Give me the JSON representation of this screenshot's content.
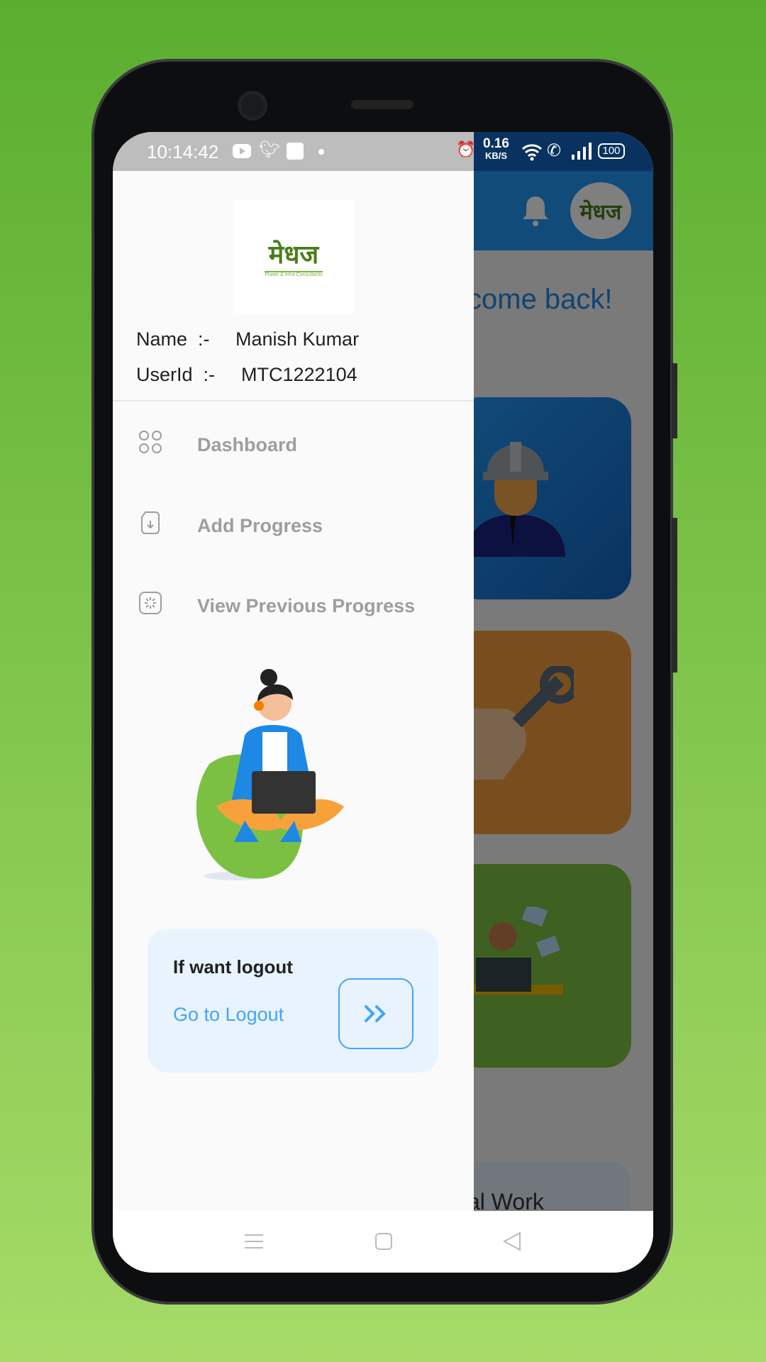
{
  "status_bar": {
    "time": "10:14:42",
    "net_speed": "0.16",
    "net_unit": "KB/S",
    "battery": "100",
    "icons": [
      "youtube-icon",
      "twitter-icon",
      "photo-icon",
      "dot-icon",
      "alarm-icon",
      "wifi-icon",
      "wifi-call-icon",
      "signal-icon",
      "battery-icon"
    ]
  },
  "drawer": {
    "logo_text": "मेधज",
    "logo_subtitle": "Power & Infra Consultants",
    "name_label": "Name  :-",
    "name_value": "Manish Kumar",
    "userid_label": "UserId  :-",
    "userid_value": "MTC1222104",
    "menu": [
      {
        "label": "Dashboard",
        "icon": "grid-icon"
      },
      {
        "label": "Add Progress",
        "icon": "file-download-icon"
      },
      {
        "label": "View Previous Progress",
        "icon": "loading-icon"
      }
    ],
    "logout_title": "If want logout",
    "logout_link": "Go to Logout"
  },
  "background_app": {
    "welcome_partial": "come back!",
    "bottom_card_partial": "al Work"
  },
  "colors": {
    "accent": "#42a5f5",
    "appbar": "#2196f3",
    "background_top": "#5aae2f",
    "background_bottom": "#a6db68"
  }
}
